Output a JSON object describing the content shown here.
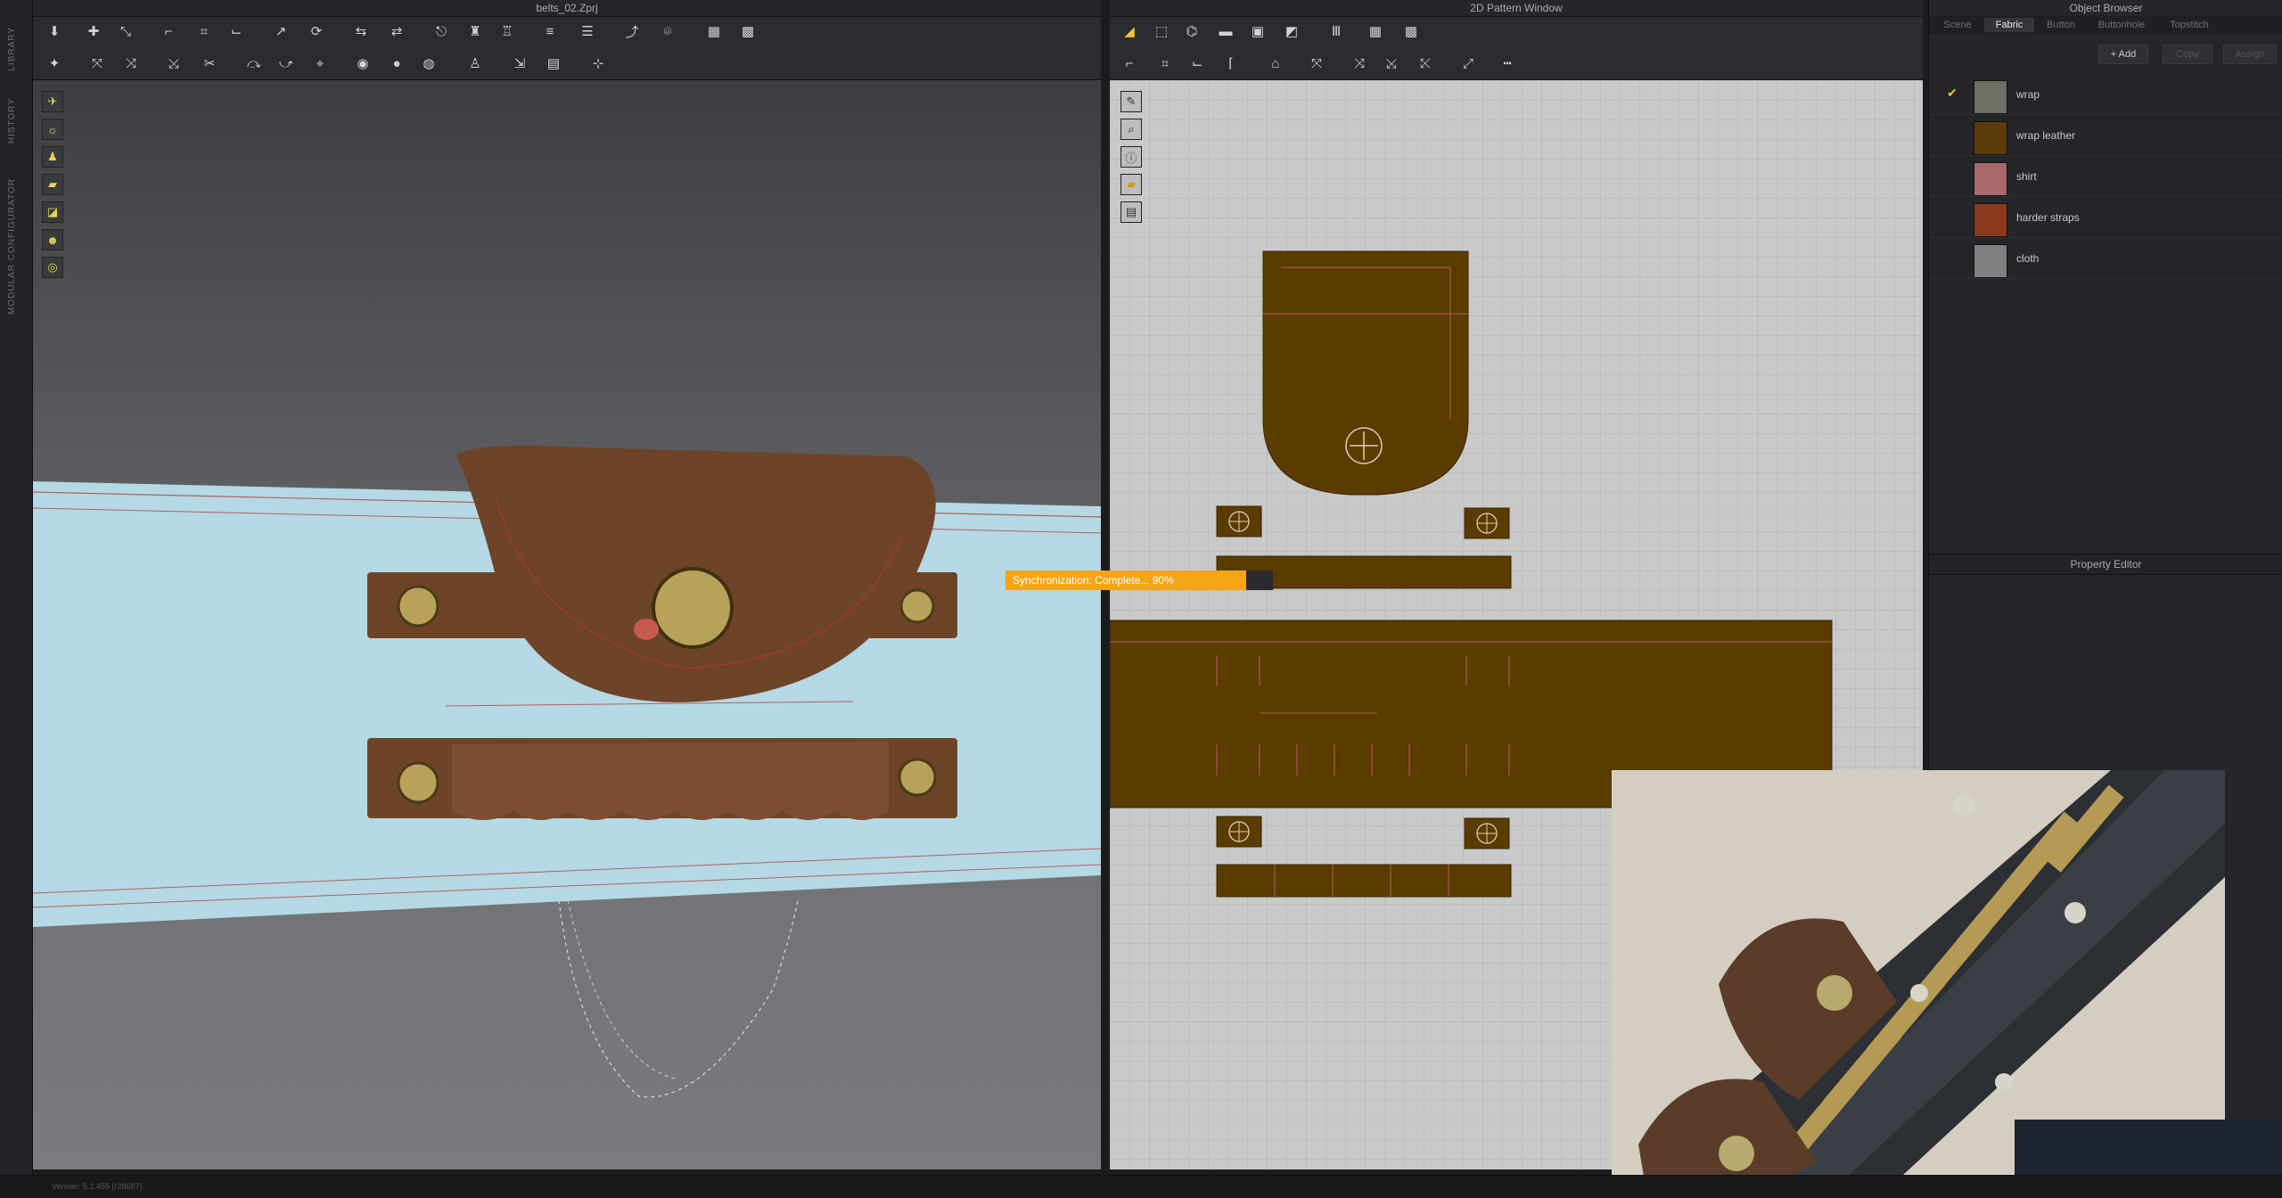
{
  "app": {
    "project_title": "belts_02.Zprj",
    "pattern_window_title": "2D Pattern Window",
    "version": "Version: 5.1.455 (r28687)"
  },
  "left_strip": {
    "labels": [
      "LIBRARY",
      "HISTORY",
      "MODULAR CONFIGURATOR"
    ]
  },
  "sync": {
    "text": "Synchronization: Complete... 90%",
    "progress": 0.9,
    "color": "#f3a515"
  },
  "object_browser": {
    "title": "Object Browser",
    "tabs": [
      "Scene",
      "Fabric",
      "Button",
      "Buttonhole",
      "Topstitch"
    ],
    "active_tab": "Fabric",
    "buttons": {
      "add": "+ Add",
      "copy": "Copy",
      "assign": "Assign"
    },
    "fabrics": [
      {
        "name": "wrap",
        "color": "#6b6f66",
        "checked": true
      },
      {
        "name": "wrap leather",
        "color": "#5c3b0a",
        "checked": false
      },
      {
        "name": "shirt",
        "color": "#a7686c",
        "checked": false
      },
      {
        "name": "harder straps",
        "color": "#8a3a1c",
        "checked": false
      },
      {
        "name": "cloth",
        "color": "#808080",
        "checked": false
      }
    ]
  },
  "property_editor": {
    "title": "Property Editor"
  },
  "colors": {
    "pattern_fill": "#5a3b00",
    "belt_blue": "#b4d9e4",
    "leather": "#6e4428",
    "brass": "#b7a25a"
  }
}
